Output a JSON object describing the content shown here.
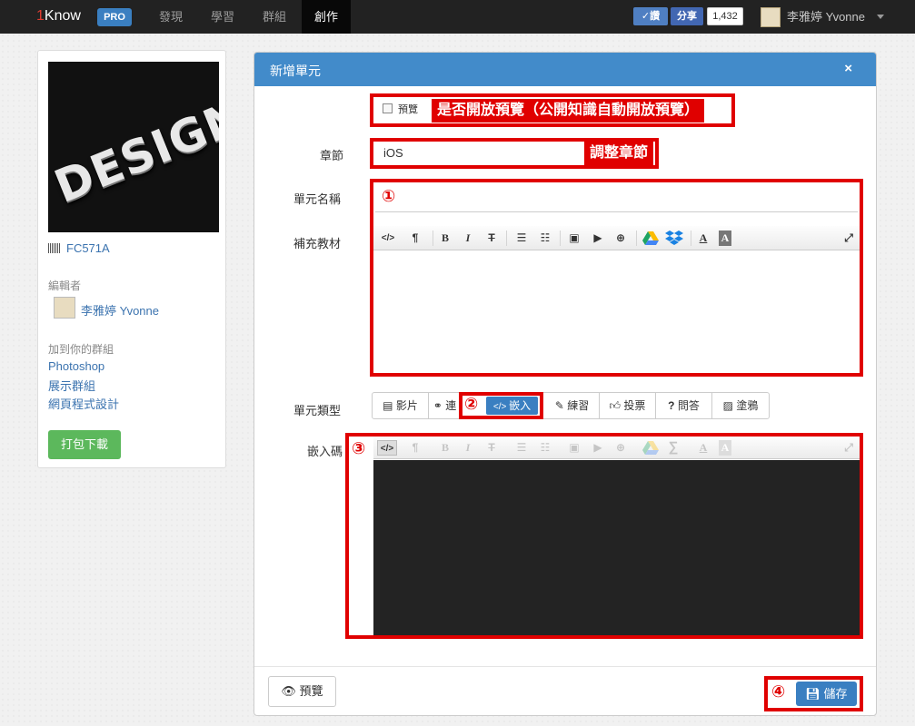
{
  "nav": {
    "brand_one": "1",
    "brand_rest": "Know",
    "pro": "PRO",
    "links": [
      "發現",
      "學習",
      "群組",
      "創作"
    ],
    "twitter_label": "✓讚",
    "share_label": "分享",
    "share_count": "1,432",
    "user_name": "李雅婷 Yvonne"
  },
  "sidebar": {
    "cover_text": "DESIGN",
    "code": "FC571A",
    "editor_label": "編輯者",
    "editor_name": "李雅婷 Yvonne",
    "group_label": "加到你的群組",
    "groups": [
      "Photoshop",
      "展示群組",
      "網頁程式設計"
    ],
    "download_label": "打包下載"
  },
  "modal": {
    "title": "新增單元",
    "close": "×",
    "preview_checkbox": "預覽",
    "preview_note": "是否開放預覽（公開知識自動開放預覽）",
    "chapter_label": "章節",
    "chapter_value": "iOS",
    "chapter_note": "調整章節",
    "unit_name_label": "單元名稱",
    "material_label": "補充教材",
    "unit_type_label": "單元類型",
    "embed_label": "嵌入碼",
    "unit_types": [
      "影片",
      "連",
      "嵌入",
      "練習",
      "投票",
      "問答",
      "塗鴉"
    ],
    "marker_1": "①",
    "marker_2": "②",
    "marker_3": "③",
    "marker_4": "④",
    "footer_preview": "預覽",
    "footer_save": "儲存"
  },
  "toolbar": {
    "code": "</>",
    "para": "¶",
    "bold": "B",
    "italic": "I",
    "strike": "T",
    "ul": "☰",
    "ol": "☷",
    "image": "▣",
    "video": "▶",
    "link": "⊕",
    "sigma": "∑",
    "font_color": "A",
    "bg_color": "A",
    "expand": "⤢"
  }
}
